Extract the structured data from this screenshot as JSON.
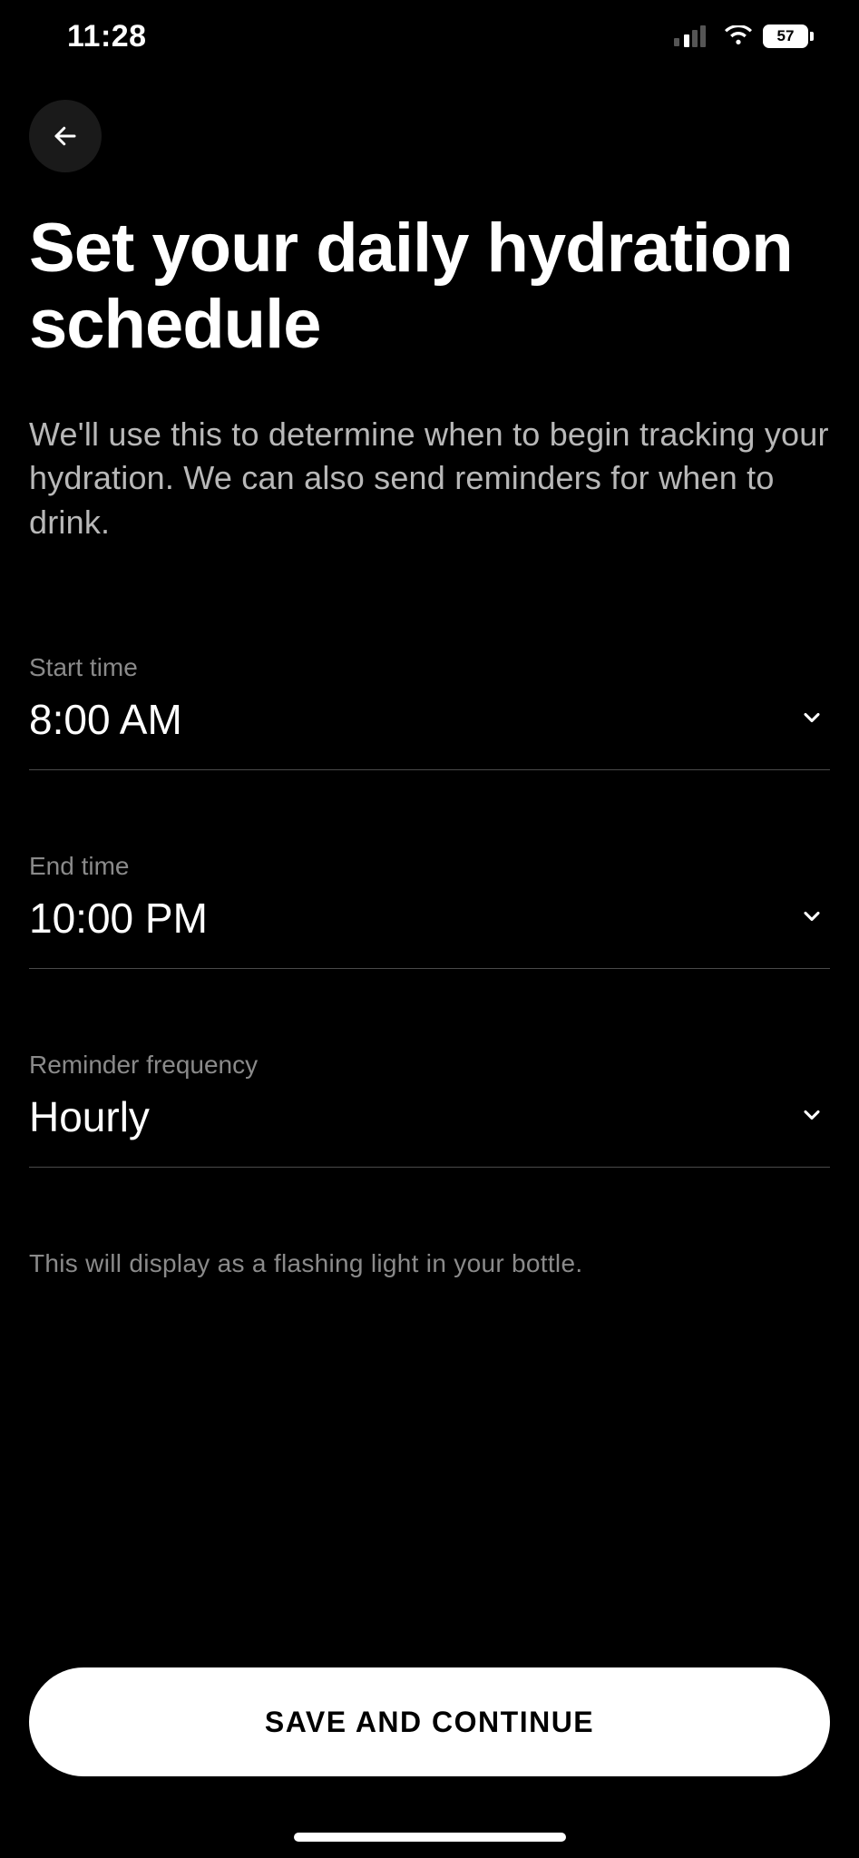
{
  "status": {
    "time": "11:28",
    "battery": "57"
  },
  "header": {
    "title": "Set your daily hydration schedule",
    "subtitle": "We'll use this to determine when to begin tracking your hydration. We can also send reminders for when to drink."
  },
  "fields": {
    "start": {
      "label": "Start time",
      "value": "8:00 AM"
    },
    "end": {
      "label": "End time",
      "value": "10:00 PM"
    },
    "frequency": {
      "label": "Reminder frequency",
      "value": "Hourly",
      "helper": "This will display as a flashing light in your bottle."
    }
  },
  "actions": {
    "primary": "SAVE AND CONTINUE"
  }
}
